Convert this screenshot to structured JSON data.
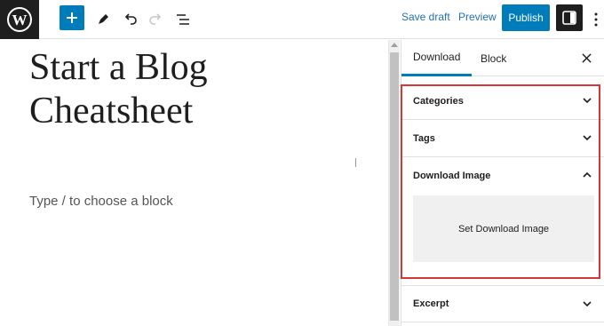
{
  "toolbar": {
    "logo_icon": "wordpress-logo",
    "add_icon": "plus-icon",
    "edit_icon": "pencil-icon",
    "undo_icon": "undo-icon",
    "redo_icon": "redo-icon",
    "list_icon": "list-view-icon",
    "save_draft_label": "Save draft",
    "preview_label": "Preview",
    "publish_label": "Publish",
    "sidebar_icon": "sidebar-toggle-icon",
    "more_icon": "more-vertical-icon"
  },
  "editor": {
    "title": "Start a Blog Cheatsheet",
    "block_placeholder": "Type / to choose a block"
  },
  "sidebar": {
    "tabs": [
      "Download",
      "Block"
    ],
    "active_tab": "Download",
    "close_icon": "close-icon",
    "panels": [
      {
        "label": "Categories",
        "expanded": false
      },
      {
        "label": "Tags",
        "expanded": false
      },
      {
        "label": "Download Image",
        "expanded": true
      },
      {
        "label": "Excerpt",
        "expanded": false
      }
    ],
    "set_image_label": "Set Download Image"
  },
  "colors": {
    "accent": "#007cba",
    "highlight_border": "#d63638",
    "logo_bg": "#1e1e1e"
  }
}
